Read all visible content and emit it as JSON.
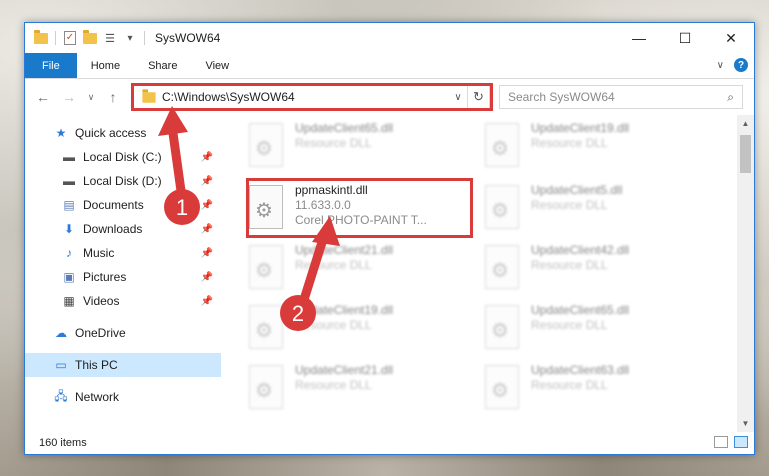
{
  "window": {
    "title": "SysWOW64"
  },
  "titlebar": {
    "qat_dropdown": "▾",
    "controls": {
      "minimize": "—",
      "maximize": "☐",
      "close": "✕"
    }
  },
  "ribbon": {
    "tabs": [
      "File",
      "Home",
      "Share",
      "View"
    ],
    "expand_icon": "∨",
    "help": "?"
  },
  "address": {
    "path": "C:\\Windows\\SysWOW64",
    "search_placeholder": "Search SysWOW64"
  },
  "navigation": {
    "items": [
      {
        "label": "Quick access",
        "icon": "star-icon",
        "pinned": false
      },
      {
        "label": "Local Disk (C:)",
        "icon": "drive-icon",
        "pinned": true
      },
      {
        "label": "Local Disk (D:)",
        "icon": "drive-icon",
        "pinned": true
      },
      {
        "label": "Documents",
        "icon": "document-icon",
        "pinned": true
      },
      {
        "label": "Downloads",
        "icon": "download-icon",
        "pinned": true
      },
      {
        "label": "Music",
        "icon": "music-icon",
        "pinned": true
      },
      {
        "label": "Pictures",
        "icon": "picture-icon",
        "pinned": true
      },
      {
        "label": "Videos",
        "icon": "video-icon",
        "pinned": true
      },
      {
        "label": "OneDrive",
        "icon": "cloud-icon",
        "pinned": false
      },
      {
        "label": "This PC",
        "icon": "computer-icon",
        "pinned": false,
        "selected": true
      },
      {
        "label": "Network",
        "icon": "network-icon",
        "pinned": false
      }
    ]
  },
  "files": {
    "left": [
      {
        "name": "UpdateClient65.dll",
        "desc": "Resource DLL"
      },
      {
        "name": "ppmaskintl.dll",
        "version": "11.633.0.0",
        "desc": "Corel PHOTO-PAINT T...",
        "focused": true
      },
      {
        "name": "UpdateClient21.dll",
        "desc": "Resource DLL"
      },
      {
        "name": "UpdateClient19.dll",
        "desc": "Resource DLL"
      },
      {
        "name": "UpdateClient21.dll",
        "desc": "Resource DLL"
      }
    ],
    "right": [
      {
        "name": "UpdateClient19.dll",
        "desc": "Resource DLL"
      },
      {
        "name": "UpdateClient5.dll",
        "desc": "Resource DLL"
      },
      {
        "name": "UpdateClient42.dll",
        "desc": "Resource DLL"
      },
      {
        "name": "UpdateClient65.dll",
        "desc": "Resource DLL"
      },
      {
        "name": "UpdateClient63.dll",
        "desc": "Resource DLL"
      }
    ]
  },
  "status": {
    "item_count": "160 items"
  },
  "annotations": {
    "step1": "1",
    "step2": "2"
  },
  "colors": {
    "accent": "#1979ca",
    "highlight": "#d93a3a",
    "selected_bg": "#cce8ff"
  }
}
